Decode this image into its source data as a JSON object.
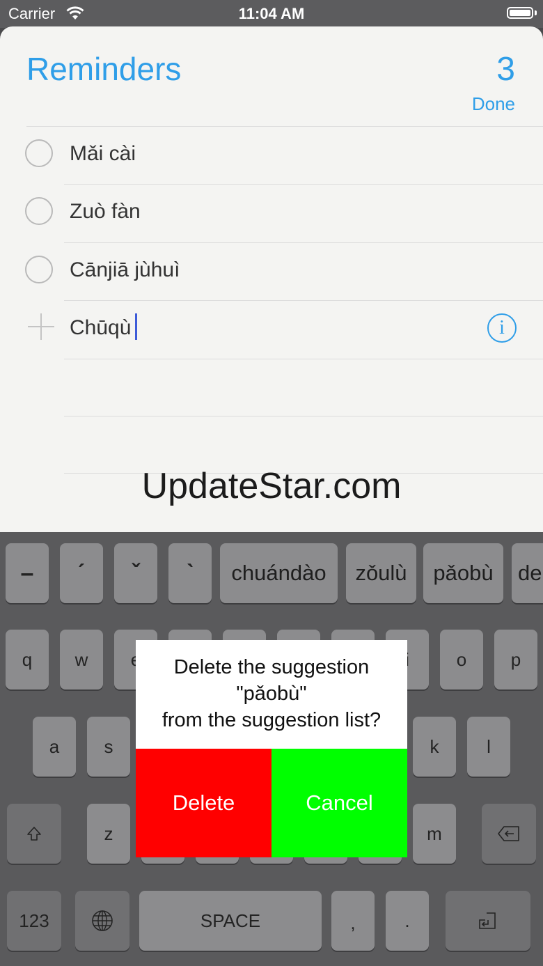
{
  "status": {
    "carrier": "Carrier",
    "time": "11:04 AM"
  },
  "header": {
    "title": "Reminders",
    "count": "3",
    "done_label": "Done"
  },
  "reminders": [
    {
      "text": "Mǎi cài"
    },
    {
      "text": "Zuò fàn"
    },
    {
      "text": "Cānjiā jùhuì"
    }
  ],
  "new_item": {
    "value": "Chūqù"
  },
  "watermark": "UpdateStar.com",
  "keyboard": {
    "tone_keys": [
      "–",
      "ˊ",
      "ˇ",
      "ˋ"
    ],
    "suggestions": [
      "chuándào",
      "zǒulù",
      "pǎobù",
      "de"
    ],
    "row1": [
      "q",
      "w",
      "e",
      "i",
      "o",
      "p"
    ],
    "row2": [
      "a",
      "s",
      "k",
      "l"
    ],
    "row3": [
      "z",
      "m"
    ],
    "numbers_label": "123",
    "space_label": "SPACE",
    "comma": ",",
    "period": "."
  },
  "dialog": {
    "line1": "Delete the suggestion",
    "line2": "\"pǎobù\"",
    "line3": "from the suggestion list?",
    "delete_label": "Delete",
    "cancel_label": "Cancel"
  },
  "colors": {
    "accent": "#2f9ee8",
    "delete": "#ff0000",
    "cancel": "#00ff00",
    "cursor": "#3d5bd8"
  }
}
